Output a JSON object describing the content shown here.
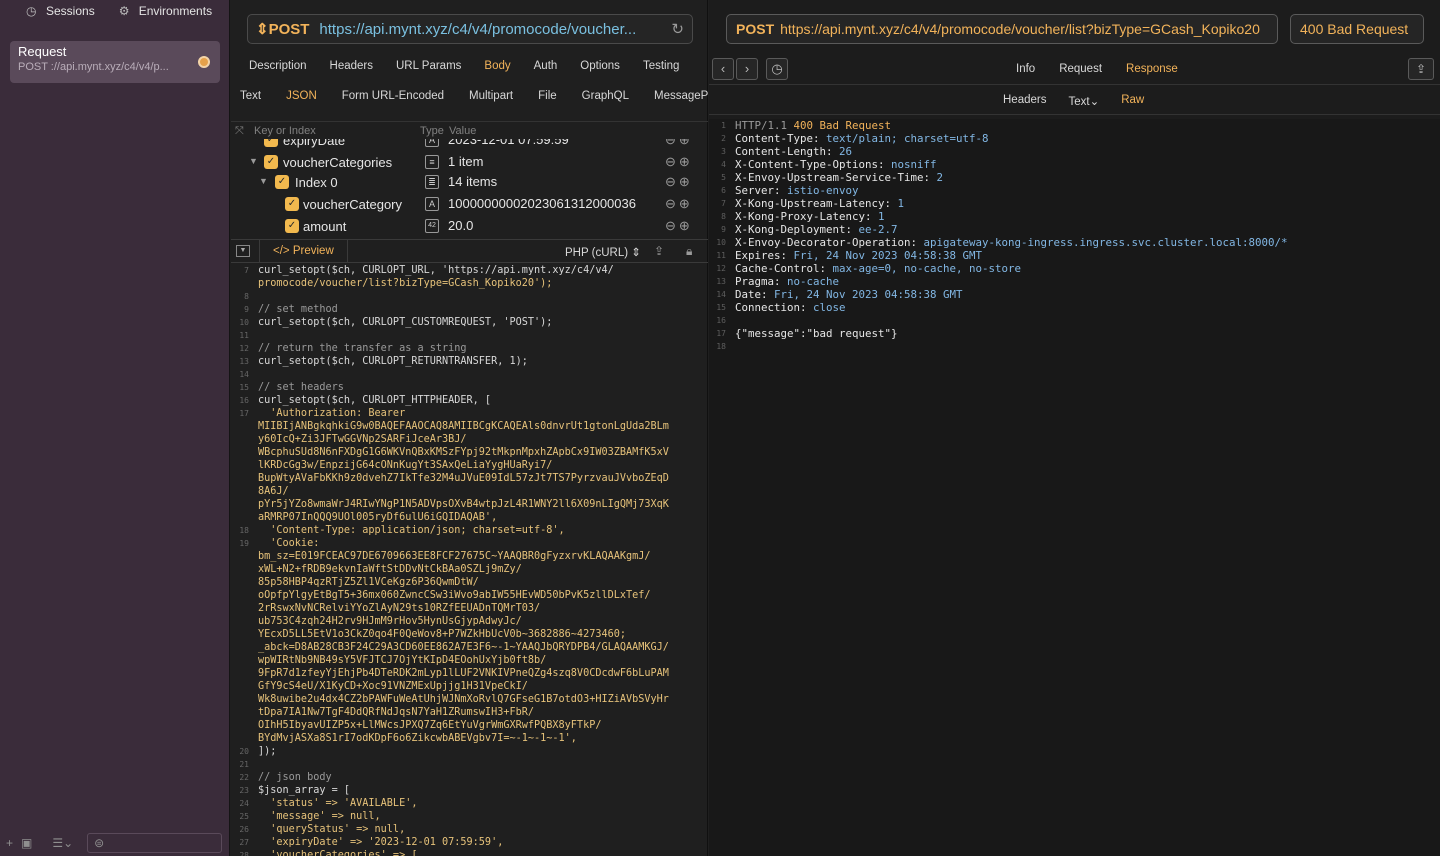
{
  "sidebar": {
    "sessions_label": "Sessions",
    "environments_label": "Environments",
    "request": {
      "title": "Request",
      "subtitle": "POST ://api.mynt.xyz/c4/v4/p..."
    }
  },
  "request": {
    "method": "POST",
    "url_display": "https://api.mynt.xyz/c4/v4/promocode/voucher...",
    "tabs": [
      "Description",
      "Headers",
      "URL Params",
      "Body",
      "Auth",
      "Options",
      "Testing"
    ],
    "active_tab": "Body",
    "body_tabs": [
      "Text",
      "JSON",
      "Form URL-Encoded",
      "Multipart",
      "File",
      "GraphQL",
      "MessagePa"
    ],
    "active_body_tab": "JSON",
    "kv_headers": {
      "key": "Key or Index",
      "type": "Type",
      "value": "Value"
    },
    "tree": [
      {
        "key": "expiryDate",
        "type": "A",
        "value": "2023-12-01 07:59:59"
      },
      {
        "key": "voucherCategories",
        "type": "≡",
        "value": "1 item"
      },
      {
        "key": "Index 0",
        "type": "≣",
        "value": "14 items"
      },
      {
        "key": "voucherCategory",
        "type": "A",
        "value": "10000000002023061312000036"
      },
      {
        "key": "amount",
        "type": "42",
        "value": "20.0"
      }
    ]
  },
  "codegen": {
    "preview_label": "Preview",
    "language": "PHP (cURL)",
    "lines": [
      {
        "n": "7",
        "t": "curl_setopt($ch, CURLOPT_URL, 'https://api.mynt.xyz/c4/v4/"
      },
      {
        "n": "",
        "t": "promocode/voucher/list?bizType=GCash_Kopiko20');"
      },
      {
        "n": "8",
        "t": ""
      },
      {
        "n": "9",
        "t": "// set method"
      },
      {
        "n": "10",
        "t": "curl_setopt($ch, CURLOPT_CUSTOMREQUEST, 'POST');"
      },
      {
        "n": "11",
        "t": ""
      },
      {
        "n": "12",
        "t": "// return the transfer as a string"
      },
      {
        "n": "13",
        "t": "curl_setopt($ch, CURLOPT_RETURNTRANSFER, 1);"
      },
      {
        "n": "14",
        "t": ""
      },
      {
        "n": "15",
        "t": "// set headers"
      },
      {
        "n": "16",
        "t": "curl_setopt($ch, CURLOPT_HTTPHEADER, ["
      },
      {
        "n": "17",
        "t": "  'Authorization: Bearer"
      },
      {
        "n": "",
        "t": "MIIBIjANBgkqhkiG9w0BAQEFAAOCAQ8AMIIBCgKCAQEAls0dnvrUt1gtonLgUda2BLm"
      },
      {
        "n": "",
        "t": "y60IcQ+Zi3JFTwGGVNp2SARFiJceAr3BJ/"
      },
      {
        "n": "",
        "t": "WBcphuSUd8N6nFXDgG1G6WKVnQBxKMSzFYpj92tMkpnMpxhZApbCx9IW03ZBAMfK5xV"
      },
      {
        "n": "",
        "t": "lKRDcGg3w/EnpzijG64cONnKugYt3SAxQeLiaYygHUaRyi7/"
      },
      {
        "n": "",
        "t": "BupWtyAVaFbKKh9z0dvehZ7IkTfe32M4uJVuE09IdL57zJt7TS7PyrzvauJVvboZEqD"
      },
      {
        "n": "",
        "t": "8A6J/"
      },
      {
        "n": "",
        "t": "pYr5jYZo8wmaWrJ4RIwYNgP1N5ADVpsOXvB4wtpJzL4R1WNY2ll6X09nLIgQMj73XqK"
      },
      {
        "n": "",
        "t": "aRMRP07InQQQ9UOl005ryDf6ulU6iGQIDAQAB',"
      },
      {
        "n": "18",
        "t": "  'Content-Type: application/json; charset=utf-8',"
      },
      {
        "n": "19",
        "t": "  'Cookie:"
      },
      {
        "n": "",
        "t": "bm_sz=E019FCEAC97DE6709663EE8FCF27675C~YAAQBR0gFyzxrvKLAQAAKgmJ/"
      },
      {
        "n": "",
        "t": "xWL+N2+fRDB9ekvnIaWftStDDvNtCkBAa0SZLj9mZy/"
      },
      {
        "n": "",
        "t": "85p58HBP4qzRTjZ5Zl1VCeKgz6P36QwmDtW/"
      },
      {
        "n": "",
        "t": "oOpfpYlgyEtBgT5+36mx060ZwncCSw3iWvo9abIW55HEvWD50bPvK5zllDLxTef/"
      },
      {
        "n": "",
        "t": "2rRswxNvNCRelviYYoZlAyN29ts10RZfEEUADnTQMrT03/"
      },
      {
        "n": "",
        "t": "ub753C4zqh24H2rv9HJmM9rHov5HynUsGjypAdwyJc/"
      },
      {
        "n": "",
        "t": "YEcxD5LL5EtV1o3CkZ0qo4F0QeWov8+P7WZkHbUcV0b~3682886~4273460;"
      },
      {
        "n": "",
        "t": "_abck=D8AB28CB3F24C29A3CD60EE862A7E3F6~-1~YAAQJbQRYDPB4/GLAQAAMKGJ/"
      },
      {
        "n": "",
        "t": "wpWIRtNb9NB49sY5VFJTCJ7OjYtKIpD4EOohUxYjb0ft8b/"
      },
      {
        "n": "",
        "t": "9FpR7d1zfeyYjEhjPb4DTeRDK2mLyp1lLUF2VNKIVPneQZg4szq8V0CDcdwF6bLuPAM"
      },
      {
        "n": "",
        "t": "GfY9cS4eU/X1KyCD+Xoc91VNZMExUpjjg1H31VpeCkI/"
      },
      {
        "n": "",
        "t": "Wk8uwibe2u4dx4CZ2bPAWFuWeAtUhjWJNmXoRvlQ7GFseG1B7otdO3+HIZiAVbSVyHr"
      },
      {
        "n": "",
        "t": "tDpa7IA1Nw7TgF4DdQRfNdJqsN7YaH1ZRumswIH3+FbR/"
      },
      {
        "n": "",
        "t": "OIhH5IbyavUIZP5x+LlMWcsJPXQ7Zq6EtYuVgrWmGXRwfPQBX8yFTkP/"
      },
      {
        "n": "",
        "t": "BYdMvjASXa8S1rI7odKDpF6o6ZikcwbABEVgbv7I=~-1~-1~-1',"
      },
      {
        "n": "20",
        "t": "]);"
      },
      {
        "n": "21",
        "t": ""
      },
      {
        "n": "22",
        "t": "// json body"
      },
      {
        "n": "23",
        "t": "$json_array = ["
      },
      {
        "n": "24",
        "t": "  'status' => 'AVAILABLE',"
      },
      {
        "n": "25",
        "t": "  'message' => null,"
      },
      {
        "n": "26",
        "t": "  'queryStatus' => null,"
      },
      {
        "n": "27",
        "t": "  'expiryDate' => '2023-12-01 07:59:59',"
      },
      {
        "n": "28",
        "t": "  'voucherCategories' => ["
      }
    ]
  },
  "response": {
    "method": "POST",
    "url": "https://api.mynt.xyz/c4/v4/promocode/voucher/list?bizType=GCash_Kopiko20",
    "status": "400 Bad Request",
    "tabs": [
      "Info",
      "Request",
      "Response"
    ],
    "active_tab": "Response",
    "sub_tabs": [
      "Headers",
      "Text",
      "Raw"
    ],
    "active_sub_tab": "Raw",
    "raw_lines": [
      {
        "n": "1",
        "k": "HTTP/1.1 ",
        "v": "400 Bad Request",
        "status": true
      },
      {
        "n": "2",
        "k": "Content-Type: ",
        "v": "text/plain; charset=utf-8"
      },
      {
        "n": "3",
        "k": "Content-Length: ",
        "v": "26"
      },
      {
        "n": "4",
        "k": "X-Content-Type-Options: ",
        "v": "nosniff"
      },
      {
        "n": "5",
        "k": "X-Envoy-Upstream-Service-Time: ",
        "v": "2"
      },
      {
        "n": "6",
        "k": "Server: ",
        "v": "istio-envoy"
      },
      {
        "n": "7",
        "k": "X-Kong-Upstream-Latency: ",
        "v": "1"
      },
      {
        "n": "8",
        "k": "X-Kong-Proxy-Latency: ",
        "v": "1"
      },
      {
        "n": "9",
        "k": "X-Kong-Deployment: ",
        "v": "ee-2.7"
      },
      {
        "n": "10",
        "k": "X-Envoy-Decorator-Operation: ",
        "v": "apigateway-kong-ingress.ingress.svc.cluster.local:8000/*"
      },
      {
        "n": "11",
        "k": "Expires: ",
        "v": "Fri, 24 Nov 2023 04:58:38 GMT"
      },
      {
        "n": "12",
        "k": "Cache-Control: ",
        "v": "max-age=0, no-cache, no-store"
      },
      {
        "n": "13",
        "k": "Pragma: ",
        "v": "no-cache"
      },
      {
        "n": "14",
        "k": "Date: ",
        "v": "Fri, 24 Nov 2023 04:58:38 GMT"
      },
      {
        "n": "15",
        "k": "Connection: ",
        "v": "close"
      },
      {
        "n": "16",
        "k": "",
        "v": ""
      },
      {
        "n": "17",
        "k": "{\"message\":\"bad request\"}",
        "v": ""
      },
      {
        "n": "18",
        "k": "",
        "v": ""
      }
    ]
  }
}
